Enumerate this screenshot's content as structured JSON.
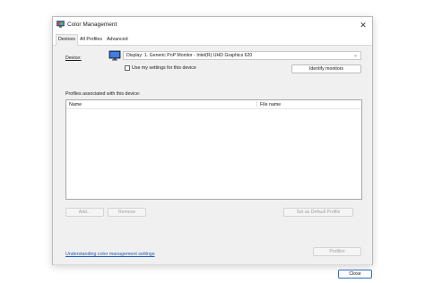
{
  "window": {
    "title": "Color Management",
    "close_glyph": "✕"
  },
  "tabs": [
    {
      "label": "Devices",
      "active": true
    },
    {
      "label": "All Profiles",
      "active": false
    },
    {
      "label": "Advanced",
      "active": false
    }
  ],
  "devices": {
    "device_label": "Device:",
    "device_value": "Display: 1. Generic PnP Monitor - Intel(R) UHD Graphics 620",
    "dropdown_glyph": "⌄",
    "use_my_settings_label": "Use my settings for this device",
    "use_my_settings_checked": false,
    "identify_button": "Identify monitors",
    "profiles_group_label": "Profiles associated with this device:",
    "columns": [
      "Name",
      "File name"
    ],
    "rows": [],
    "add_button": "Add...",
    "remove_button": "Remove",
    "set_default_button": "Set as Default Profile",
    "help_link": "Understanding color management settings",
    "profiles_button": "Profiles"
  },
  "footer": {
    "close_button": "Close"
  },
  "icons": {
    "app": "color-management-icon",
    "monitor": "monitor-icon"
  },
  "colors": {
    "link": "#1f5fb3",
    "focus_border": "#2f6fc3"
  }
}
